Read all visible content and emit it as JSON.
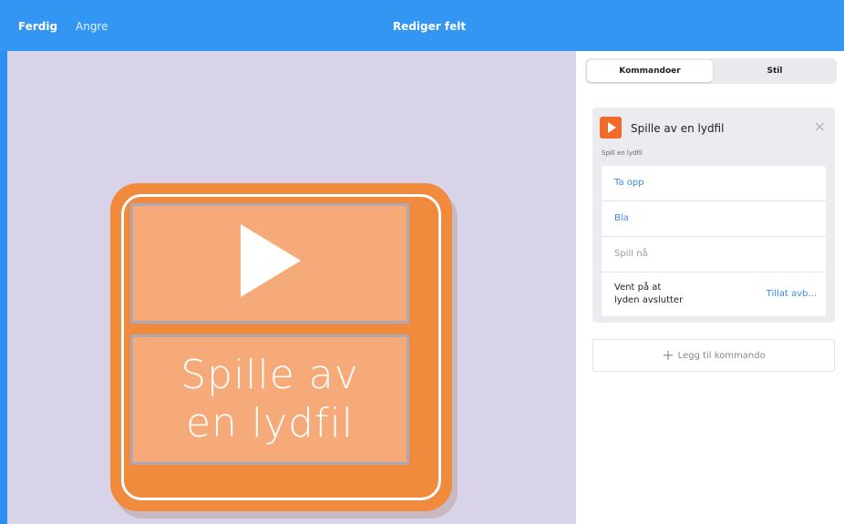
{
  "topbar": {
    "done_label": "Ferdig",
    "undo_label": "Angre",
    "title": "Rediger felt",
    "color": "#3296f2"
  },
  "tile": {
    "label": "Spille av\nen lydfil",
    "icon": "play-icon",
    "color": "#f08a3c"
  },
  "panel": {
    "tabs": [
      {
        "label": "Kommandoer",
        "active": true
      },
      {
        "label": "Stil",
        "active": false
      }
    ],
    "command": {
      "title": "Spille av en lydfil",
      "icon": "play-icon",
      "subtitle": "Spill en lydfil",
      "options": [
        {
          "label": "Ta opp"
        },
        {
          "label": "Bla"
        },
        {
          "label": "Spill nå"
        }
      ],
      "wait_label": "Vent på at\nlyden avslutter",
      "wait_value": "Tillat avb..."
    },
    "add_command_label": "Legg til kommando"
  }
}
